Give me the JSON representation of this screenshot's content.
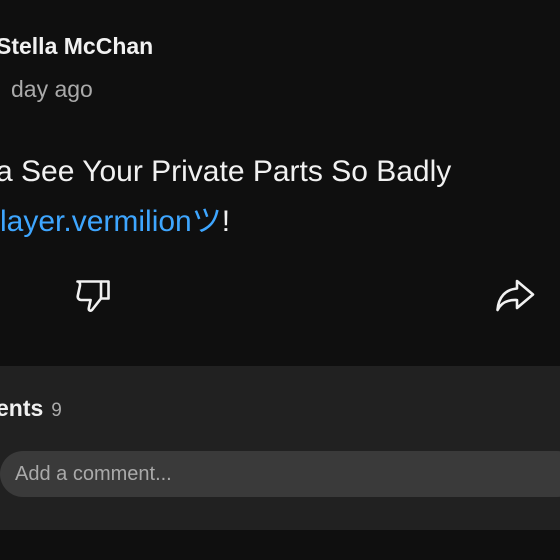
{
  "post": {
    "author": "Stella McChan",
    "time": "day ago",
    "text_line1": "a See Your Private Parts So Badly",
    "mention": "layer.vermilionツ",
    "text_suffix": "!"
  },
  "actions": {
    "dislike_icon": "thumbs-down-icon",
    "share_icon": "share-icon"
  },
  "comments": {
    "title": "ents",
    "count": "9",
    "placeholder": "Add a comment..."
  },
  "colors": {
    "background": "#0f0f0f",
    "panel": "#212121",
    "input": "#3a3a3a",
    "link": "#3ea6ff",
    "text": "#f1f1f1",
    "muted": "#aaaaaa"
  }
}
